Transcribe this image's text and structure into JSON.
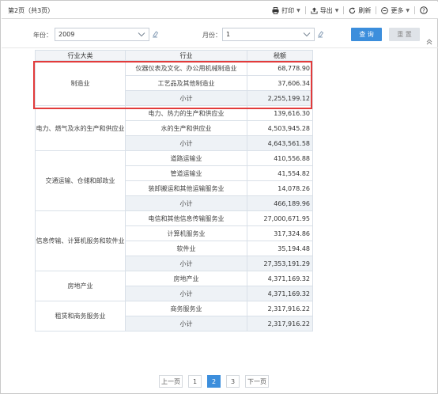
{
  "header": {
    "page_info": "第2页（共3页）",
    "tools": {
      "print": "打印",
      "export": "导出",
      "refresh": "刷新",
      "more": "更多"
    }
  },
  "filters": {
    "year_label": "年份：",
    "year_value": "2009",
    "month_label": "月份：",
    "month_value": "1",
    "query_button": "查 询",
    "reset_button": "重 置"
  },
  "table": {
    "headers": [
      "行业大类",
      "行业",
      "税额"
    ],
    "groups": [
      {
        "category": "制造业",
        "rows": [
          {
            "industry": "仪器仪表及文化、办公用机械制造业",
            "tax": "68,778.90"
          },
          {
            "industry": "工艺品及其他制造业",
            "tax": "37,606.34"
          },
          {
            "industry": "小计",
            "tax": "2,255,199.12",
            "subtotal": true
          }
        ]
      },
      {
        "category": "电力、燃气及水的生产和供应业",
        "rows": [
          {
            "industry": "电力、热力的生产和供应业",
            "tax": "139,616.30"
          },
          {
            "industry": "水的生产和供应业",
            "tax": "4,503,945.28"
          },
          {
            "industry": "小计",
            "tax": "4,643,561.58",
            "subtotal": true
          }
        ]
      },
      {
        "category": "交通运输、仓储和邮政业",
        "rows": [
          {
            "industry": "道路运输业",
            "tax": "410,556.88"
          },
          {
            "industry": "管道运输业",
            "tax": "41,554.82"
          },
          {
            "industry": "装卸搬运和其他运输服务业",
            "tax": "14,078.26"
          },
          {
            "industry": "小计",
            "tax": "466,189.96",
            "subtotal": true
          }
        ]
      },
      {
        "category": "信息传输、计算机服务和软件业",
        "rows": [
          {
            "industry": "电信和其他信息传输服务业",
            "tax": "27,000,671.95"
          },
          {
            "industry": "计算机服务业",
            "tax": "317,324.86"
          },
          {
            "industry": "软件业",
            "tax": "35,194.48"
          },
          {
            "industry": "小计",
            "tax": "27,353,191.29",
            "subtotal": true
          }
        ]
      },
      {
        "category": "房地产业",
        "rows": [
          {
            "industry": "房地产业",
            "tax": "4,371,169.32"
          },
          {
            "industry": "小计",
            "tax": "4,371,169.32",
            "subtotal": true
          }
        ]
      },
      {
        "category": "租赁和商务服务业",
        "rows": [
          {
            "industry": "商务服务业",
            "tax": "2,317,916.22"
          },
          {
            "industry": "小计",
            "tax": "2,317,916.22",
            "subtotal": true
          }
        ]
      }
    ]
  },
  "pagination": {
    "prev": "上一页",
    "pages": [
      "1",
      "2",
      "3"
    ],
    "current": "2",
    "next": "下一页"
  },
  "colors": {
    "accent": "#3c8edc",
    "highlight": "#e23b3b",
    "subtotal_bg": "#eef2f6"
  }
}
